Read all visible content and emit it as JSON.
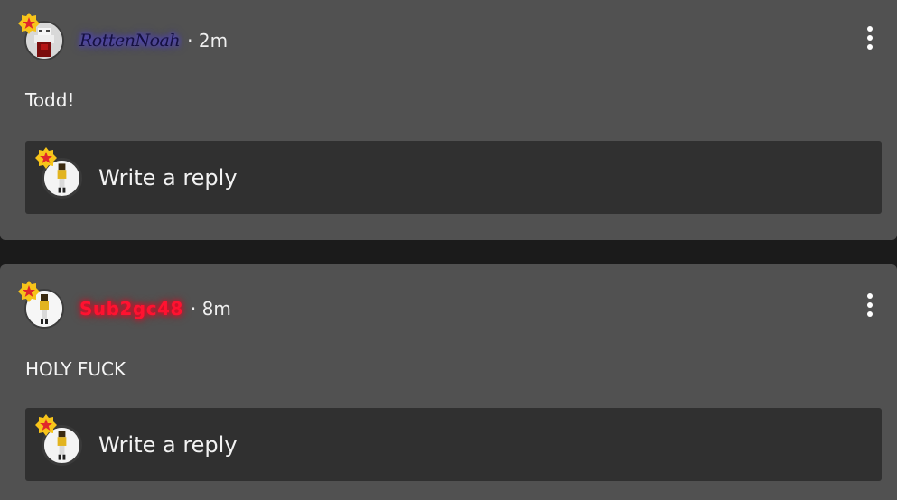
{
  "comments": [
    {
      "username": "RottenNoah",
      "time": "· 2m",
      "text": "Todd!",
      "reply_placeholder": "Write a reply"
    },
    {
      "username": "Sub2gc48",
      "time": "· 8m",
      "text": "HOLY FUCK",
      "reply_placeholder": "Write a reply"
    }
  ],
  "colors": {
    "card_bg": "#515151",
    "reply_bg": "#303030",
    "page_bg": "#1b1b1b",
    "badge_yellow": "#f7c41a",
    "badge_red": "#e0262b",
    "name_sub": "#ff1230",
    "name_rotten_glow": "#5a49ff"
  },
  "icons": {
    "badge": "star-badge-icon",
    "menu": "more-vertical-icon"
  }
}
